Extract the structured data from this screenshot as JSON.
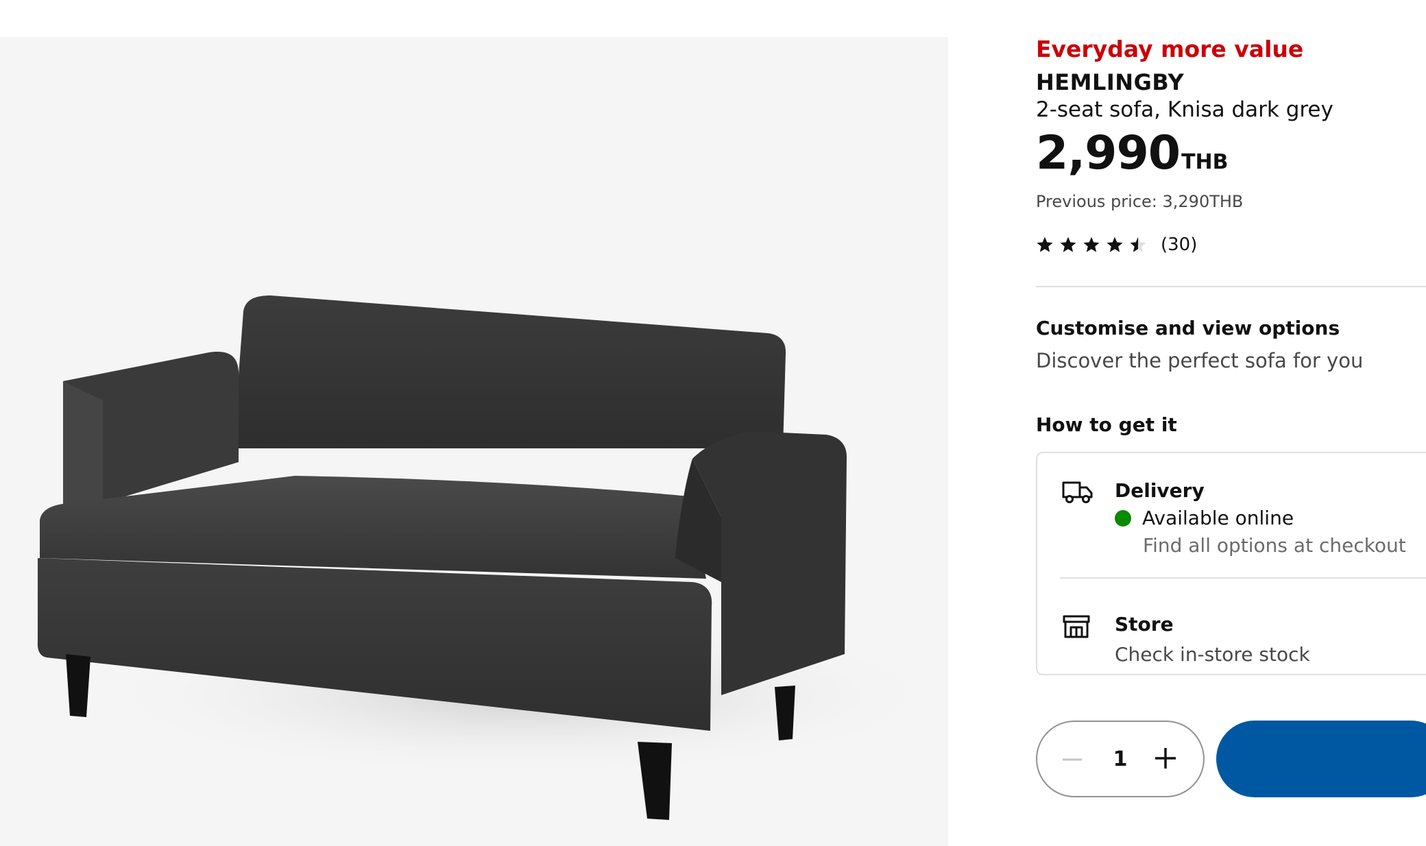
{
  "product_image": {
    "alt": "HEMLINGBY 2-seat sofa"
  },
  "product": {
    "badge": "Everyday more value",
    "name": "HEMLINGBY",
    "description": "2-seat sofa, Knisa dark grey",
    "price": "2,990",
    "currency": "THB",
    "previous_price": "Previous price: 3,290THB",
    "rating": {
      "value": 4.5,
      "max": 5,
      "count_label": "(30)"
    }
  },
  "customise": {
    "title": "Customise and view options",
    "subtitle": "Discover the perfect sofa for you"
  },
  "how_to_get": {
    "title": "How to get it",
    "delivery": {
      "title": "Delivery",
      "status": "Available online",
      "status_color": "#0a8a00",
      "note": "Find all options at checkout",
      "icon": "truck-icon"
    },
    "store": {
      "title": "Store",
      "note": "Check in-store stock",
      "icon": "store-icon"
    }
  },
  "quantity": {
    "value": "1"
  },
  "colors": {
    "badge": "#cc0008",
    "primary_button": "#0058a3",
    "available_dot": "#0a8a00"
  }
}
